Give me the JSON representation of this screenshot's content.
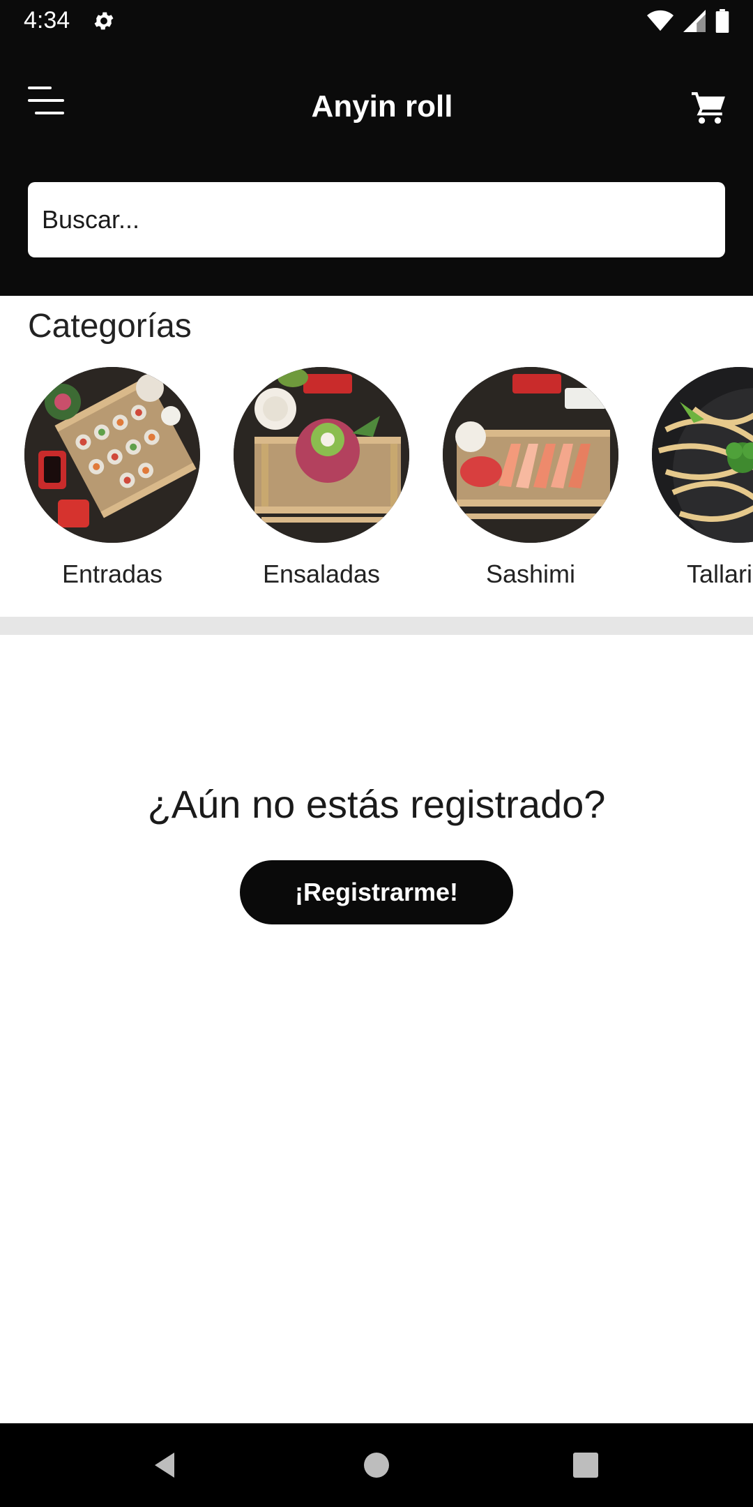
{
  "status_bar": {
    "time": "4:34",
    "icons": [
      "gear-icon",
      "wifi-icon",
      "cell-signal-icon",
      "battery-icon"
    ]
  },
  "header": {
    "title": "Anyin roll",
    "menu_icon": "menu-icon",
    "cart_icon": "cart-icon"
  },
  "search": {
    "placeholder": "Buscar..."
  },
  "categories": {
    "title": "Categorías",
    "items": [
      {
        "label": "Entradas"
      },
      {
        "label": "Ensaladas"
      },
      {
        "label": "Sashimi"
      },
      {
        "label": "Tallarines"
      }
    ]
  },
  "register": {
    "question": "¿Aún no estás registrado?",
    "button_label": "¡Registrarme!"
  },
  "nav_bar": {
    "icons": [
      "back-icon",
      "home-icon",
      "recents-icon"
    ]
  },
  "colors": {
    "header_bg": "#0b0b0b",
    "button_bg": "#0a0a0a",
    "divider": "#e6e6e6"
  }
}
